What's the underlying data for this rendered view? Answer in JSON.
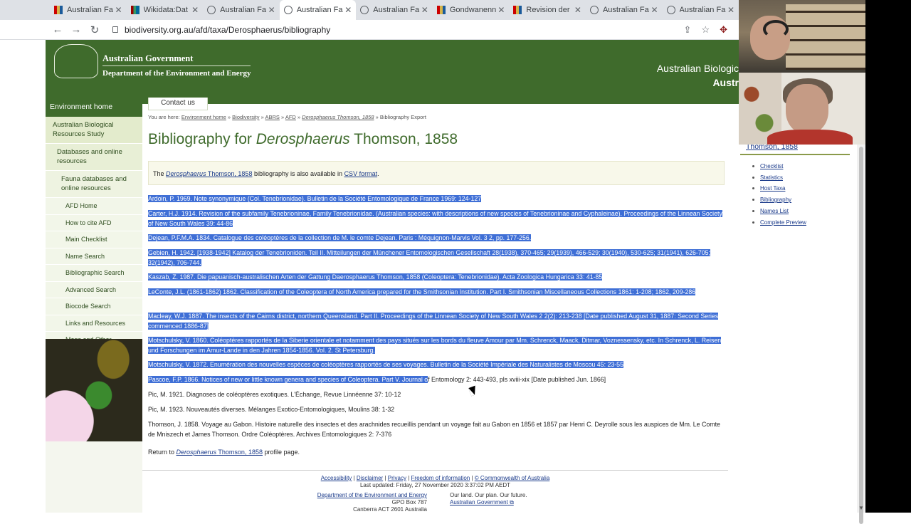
{
  "browser": {
    "tabs": [
      {
        "label": "Australian Fa",
        "icon": "flag"
      },
      {
        "label": "Wikidata:Dat",
        "icon": "wiki"
      },
      {
        "label": "Australian Fa",
        "icon": "globe"
      },
      {
        "label": "Australian Fa",
        "icon": "globe",
        "active": true
      },
      {
        "label": "Australian Fa",
        "icon": "globe"
      },
      {
        "label": "Gondwanenn",
        "icon": "flag"
      },
      {
        "label": "Revision der",
        "icon": "flag"
      },
      {
        "label": "Australian Fa",
        "icon": "globe"
      },
      {
        "label": "Australian Fa",
        "icon": "globe"
      }
    ],
    "url": "biodiversity.org.au/afd/taxa/Derosphaerus/bibliography"
  },
  "header": {
    "gov_line1": "Australian Government",
    "gov_line2": "Department of the Environment and Energy",
    "abrs_line1": "Australian Biologic",
    "abrs_line2": "Austr"
  },
  "sidebar": {
    "env_home": "Environment home",
    "items": [
      {
        "label": "Australian Biological Resources Study",
        "level": 1
      },
      {
        "label": "Databases and online resources",
        "level": 2
      },
      {
        "label": "Fauna databases and online resources",
        "level": 3
      },
      {
        "label": "AFD Home",
        "level": 4
      },
      {
        "label": "How to cite AFD",
        "level": 4
      },
      {
        "label": "Main Checklist",
        "level": 4
      },
      {
        "label": "Name Search",
        "level": 4
      },
      {
        "label": "Bibliographic Search",
        "level": 4
      },
      {
        "label": "Advanced Search",
        "level": 4
      },
      {
        "label": "Biocode Search",
        "level": 4
      },
      {
        "label": "Links and Resources",
        "level": 4
      },
      {
        "label": "Maps and Other Information",
        "level": 4
      }
    ]
  },
  "contact_us": "Contact us",
  "breadcrumb": {
    "prefix": "You are here:",
    "env": "Environment home",
    "bio": "Biodiversity",
    "abrs": "ABRS",
    "afd": "AFD",
    "taxon": "Derosphaerus Thomson, 1858",
    "current": "Bibliography Export",
    "sep": "»"
  },
  "title": {
    "prefix": "Bibliography for",
    "genus": "Derosphaerus",
    "author": "Thomson, 1858"
  },
  "note": {
    "the": "The",
    "genus": "Derosphaerus",
    "author": "Thomson, 1858",
    "mid": "bibliography is also available in",
    "csv": "CSV format",
    "end": "."
  },
  "references": [
    {
      "text": "Ardoin, P. 1969. Note synonymique (Col. Tenebrionidae). Bulletin de la Société Entomologique de France 1969: 124-127"
    },
    {
      "text": "Carter, H.J. 1914. Revision of the subfamily Tenebrioninae, Family Tenebrionidae. (Australian species: with descriptions of new species of Tenebrioninae and Cyphaleinae). Proceedings of the Linnean Society of New South Wales 39: 44-86"
    },
    {
      "text": "Dejean, P.F.M.A. 1834. Catalogue des coléoptères de la collection de M. le comte Dejean. Paris : Méquignon-Marvis Vol. 3 2, pp. 177-256."
    },
    {
      "text": "Gebien, H. 1942. [1938-1942] Katalog der Tenebrioniden. Teil II. Mitteilungen der Münchener Entomologischen Gesellschaft 28(1938), 370-465; 29(1939), 466-529; 30(1940), 530-625; 31(1941), 626-705; 32(1942), 706-744."
    },
    {
      "text": "Kaszab, Z. 1987. Die papuanisch-australischen Arten der Gattung Daerosphaerus Thomson, 1858 (Coleoptera: Tenebrionidae). Acta Zoologica Hungarica 33: 41-85"
    },
    {
      "text": "LeConte, J.L. (1861-1862) 1862. Classification of the Coleoptera of North America prepared for the Smithsonian Institution. Part I. Smithsonian Miscellaneous Collections 1861: 1-208; 1862, 209-286"
    },
    {
      "text": "Macleay, W.J. 1887. The insects of the Cairns district, northern Queensland. Part II. Proceedings of the Linnean Society of New South Wales 2 2(2): 213-238 [Date published August 31, 1887: Second Series commenced 1886-87]"
    },
    {
      "text": "Motschulsky, V. 1860. Coléoptères rapportés de la Siberie orientale et notamment des pays situés sur les bords du fleuve Amour par Mm. Schrenck, Maack, Ditmar, Voznessensky, etc. In Schrenck, L. Reisen und Forschungen im Amur-Lande in den Jahren 1854-1856. Vol. 2. St Petersburg."
    },
    {
      "text": "Motschulsky, V. 1872. Enumération des nouvelles espèces de coléoptères rapportés de ses voyages. Bulletin de la Société Impériale des Naturalistes de Moscou 45: 23-55"
    },
    {
      "sel": "Pascoe, F.P. 1866. Notices of new or little known genera and species of Coleoptera. Part V. Journal o",
      "rest": "f Entomology 2: 443-493, pls xviii-xix [Date published Jun. 1866]"
    },
    {
      "text": "Pic, M. 1921. Diagnoses de coléoptères exotiques. L'Échange, Revue Linnéenne 37: 10-12"
    },
    {
      "text": "Pic, M. 1923. Nouveautés diverses. Mélanges Exotico-Entomologiques, Moulins 38: 1-32"
    },
    {
      "text": "Thomson, J. 1858. Voyage au Gabon. Histoire naturelle des insectes et des arachnides recueillis pendant un voyage fait au Gabon en 1856 et 1857 par Henri C. Deyrolle sous les auspices de Mm. Le Comte de Mniszech et James Thomson. Ordre Coléoptères. Archives Entomologiques 2: 7-376"
    }
  ],
  "return": {
    "prefix": "Return to",
    "genus": "Derosphaerus",
    "author": "Thomson, 1858",
    "suffix": "profile page."
  },
  "footer": {
    "accessibility": "Accessibility",
    "disclaimer": "Disclaimer",
    "privacy": "Privacy",
    "foi": "Freedom of information",
    "copyright": "© Commonwealth of Australia",
    "sep": "|",
    "updated": "Last updated: Friday, 27 November 2020 3:37:02 PM AEDT",
    "dept": "Department of the Environment and Energy",
    "gpo": "GPO Box 787",
    "canberra": "Canberra ACT 2601 Australia",
    "tagline": "Our land. Our plan. Our future.",
    "gov_link": "Australian Government"
  },
  "right_sidebar": {
    "title": "Thomson, 1858",
    "links": [
      "Checklist",
      "Statistics",
      "Host Taxa",
      "Bibliography",
      "Names List",
      "Complete Preview"
    ]
  },
  "colors": {
    "header_green": "#3f6b2c",
    "selection": "#3f6fd6",
    "link": "#1a3a8a"
  }
}
